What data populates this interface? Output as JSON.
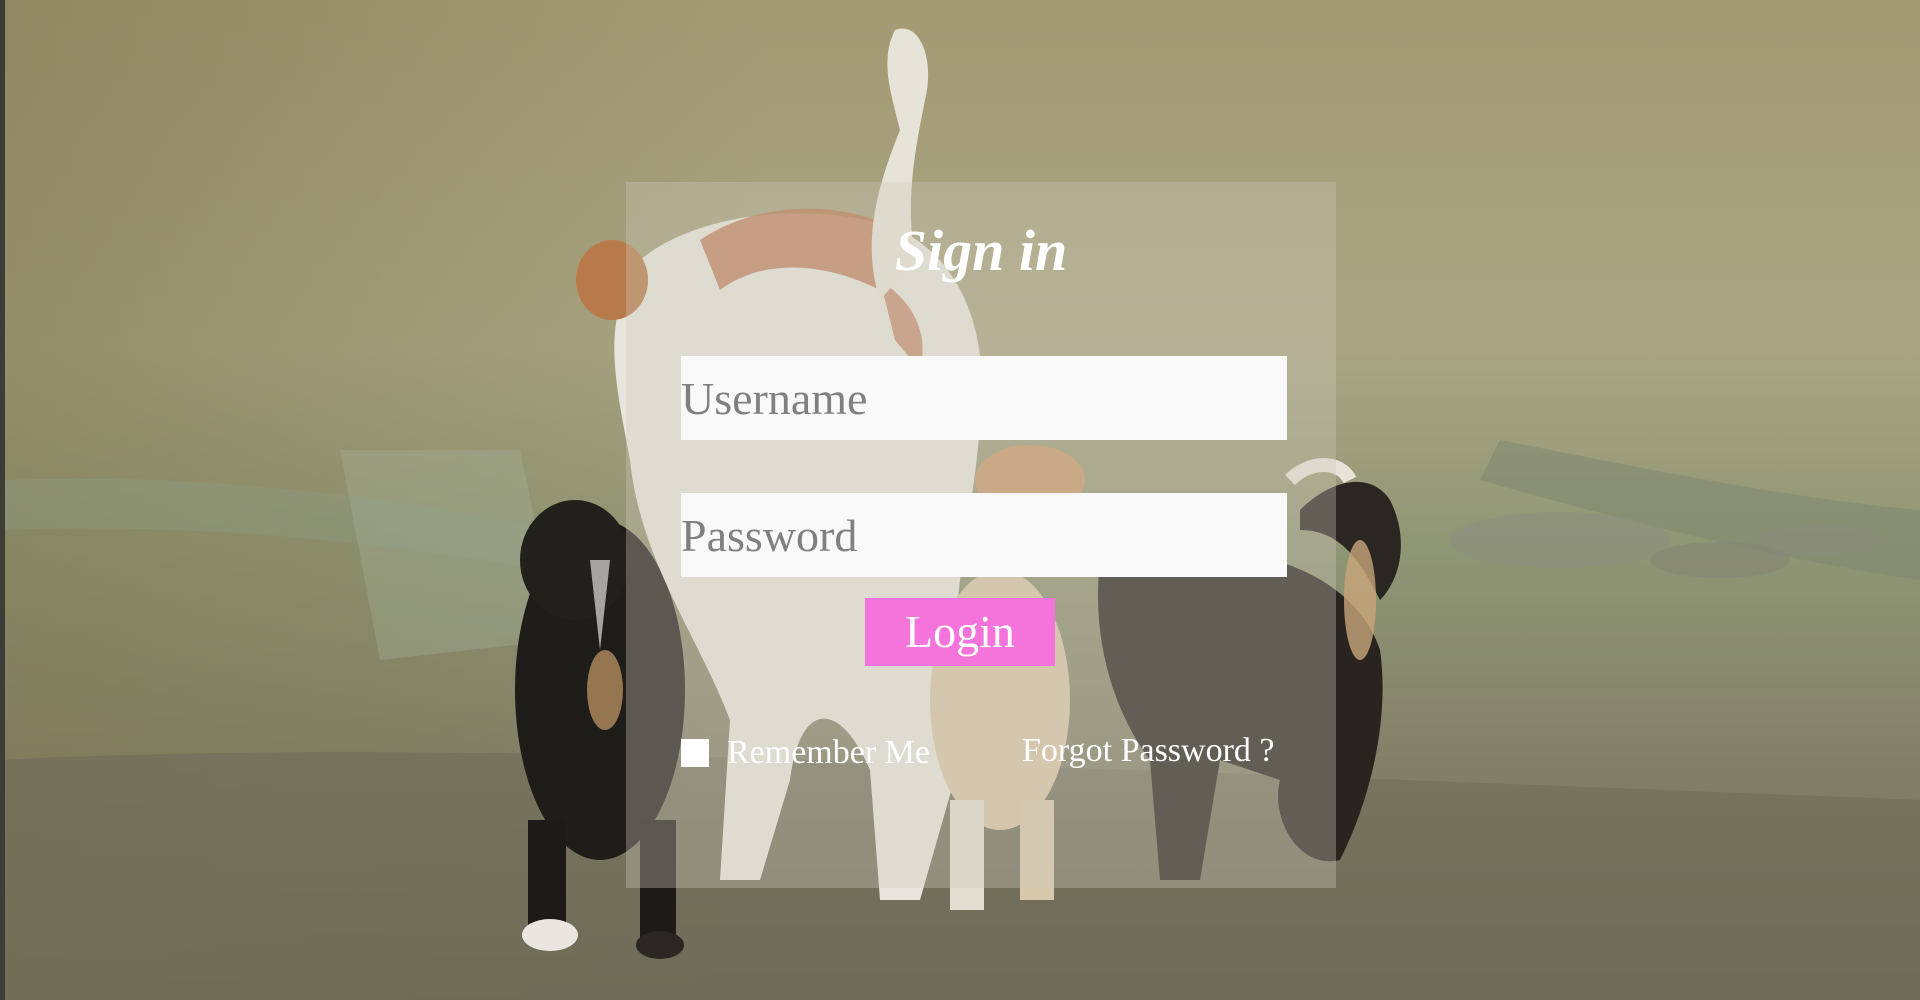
{
  "login_form": {
    "title": "Sign in",
    "username_placeholder": "Username",
    "password_placeholder": "Password",
    "login_label": "Login",
    "remember_label": "Remember Me",
    "forgot_label": "Forgot Password ?",
    "remember_checked": false
  },
  "background": {
    "subject": "dogs walking on dirt road",
    "tone_color": "#8e9472"
  },
  "colors": {
    "login_button": "#f474dc",
    "input_background": "#f9f9f9",
    "placeholder": "#808080",
    "text": "#ffffff"
  }
}
